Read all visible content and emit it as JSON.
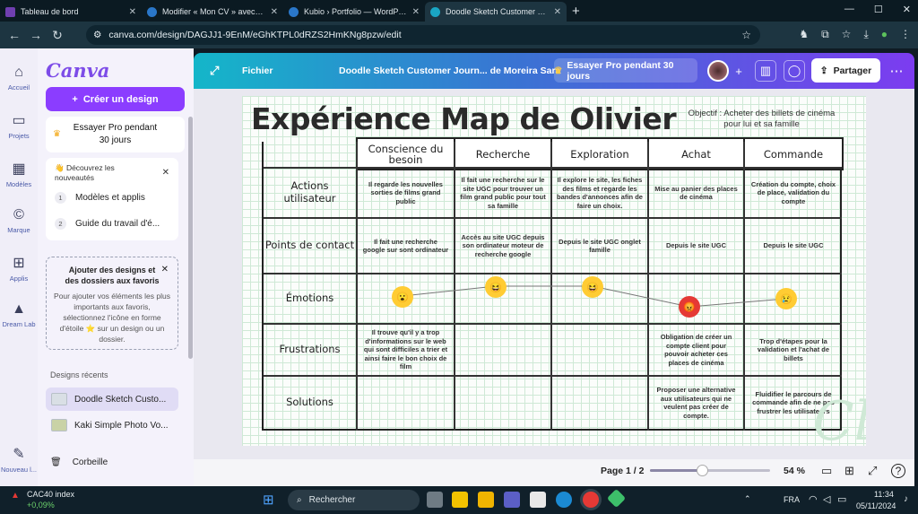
{
  "browser": {
    "tabs": [
      {
        "title": "Tableau de bord",
        "color": "#6f3fb0"
      },
      {
        "title": "Modifier « Mon CV » avec Elem",
        "color": "#2a77c9"
      },
      {
        "title": "Kubio › Portfolio — WordPress",
        "color": "#2a77c9"
      },
      {
        "title": "Doodle Sketch Customer Journ",
        "color": "#1aa6c4"
      }
    ],
    "url": "canva.com/design/DAGJJ1-9EnM/eGhKTPL0dRZS2HmKNg8pzw/edit"
  },
  "rail": {
    "items": [
      "Accueil",
      "Projets",
      "Modèles",
      "Marque",
      "Applis",
      "Dream Lab",
      "Nouveau l..."
    ]
  },
  "panel": {
    "logo": "Canva",
    "create_label": "Créer un design",
    "try_pro_line1": "Essayer Pro pendant",
    "try_pro_line2": "30 jours",
    "discover_title": "👋 Découvrez les nouveautés",
    "discover_items": [
      {
        "num": "1",
        "label": "Modèles et applis"
      },
      {
        "num": "2",
        "label": "Guide du travail d'é..."
      }
    ],
    "fav_title": "Ajouter des designs et des dossiers aux favoris",
    "fav_text": "Pour ajouter vos éléments les plus importants aux favoris, sélectionnez l'icône en forme d'étoile ⭐ sur un design ou un dossier.",
    "recent_title": "Designs récents",
    "recent": [
      "Doodle Sketch Custo...",
      "Kaki Simple Photo Vo..."
    ],
    "trash": "Corbeille"
  },
  "topbar": {
    "file_label": "Fichier",
    "doc_title": "Doodle Sketch Customer Journ... de Moreira Sara",
    "try_pro": "Essayer Pro pendant 30 jours",
    "share_label": "Partager"
  },
  "design": {
    "title": "Expérience Map de Olivier",
    "objective": "Objectif : Acheter des billets de cinéma pour lui et sa famille",
    "columns": [
      "Conscience du besoin",
      "Recherche",
      "Exploration",
      "Achat",
      "Commande"
    ],
    "rows": [
      "Actions utilisateur",
      "Points de contact",
      "Émotions",
      "Frustrations",
      "Solutions"
    ],
    "actions": [
      "Il regarde les nouvelles sorties de films grand public",
      "Il fait une recherche sur le site UGC pour trouver un film grand public pour tout sa famille",
      "Il explore le site, les fiches des films et regarde les bandes d'annonces afin de faire un choix.",
      "Mise au panier des places de cinéma",
      "Création du compte, choix de place, validation du compte"
    ],
    "touchpoints": [
      "Il fait une recherche google sur sont ordinateur",
      "Accès au site UGC depuis son ordinateur moteur de recherche google",
      "Depuis le site UGC onglet famille",
      "Depuis le site UGC",
      "Depuis le site UGC"
    ],
    "emotions": [
      "surprised",
      "laughing",
      "laughing",
      "angry",
      "sad"
    ],
    "frustrations": [
      "Il trouve qu'il y a trop d'informations sur le web qui sont difficiles a trier et ainsi faire le bon choix de film",
      "",
      "",
      "Obligation de créer un compte client pour pouvoir acheter ces places de cinéma",
      "Trop d'étapes pour la validation et l'achat de billets"
    ],
    "solutions": [
      "",
      "",
      "",
      "Proposer une alternative aux utilisateurs qui ne veulent pas créer de compte.",
      "Fluidifier le parcours de commande afin de ne pas frustrer les utilisateurs"
    ]
  },
  "bottombar": {
    "page_label": "Page 1 / 2",
    "zoom": "54 %",
    "zoom_fraction": 0.42
  },
  "taskbar": {
    "stock_name": "CAC40 index",
    "stock_change": "+0,09%",
    "search_placeholder": "Rechercher",
    "lang": "FRA",
    "time": "11:34",
    "date": "05/11/2024"
  }
}
